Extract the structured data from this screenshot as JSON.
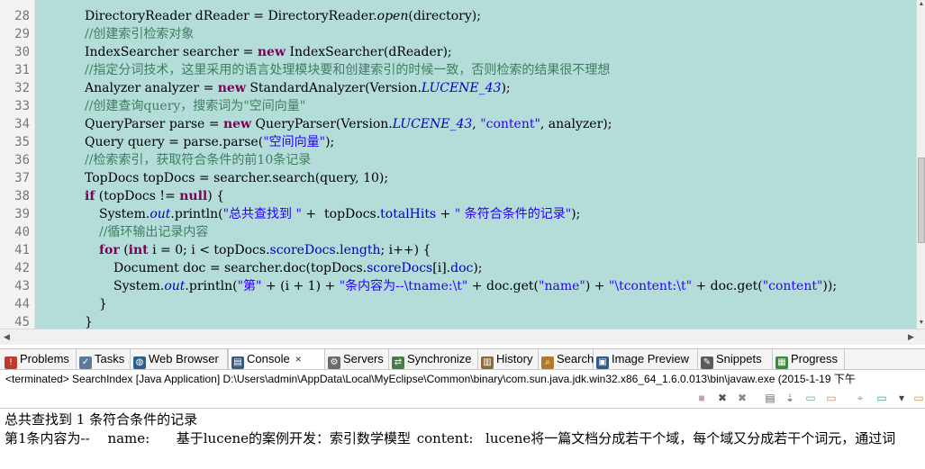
{
  "editor": {
    "line_numbers": [
      "28",
      "29",
      "30",
      "31",
      "32",
      "33",
      "34",
      "35",
      "36",
      "37",
      "38",
      "39",
      "40",
      "41",
      "42",
      "43",
      "44",
      "45"
    ],
    "lines": [
      [
        {
          "t": "DirectoryReader dReader = DirectoryReader.",
          "c": ""
        },
        {
          "t": "open",
          "c": "it"
        },
        {
          "t": "(directory);",
          "c": ""
        }
      ],
      [
        {
          "t": "//创建索引检索对象",
          "c": "cm"
        }
      ],
      [
        {
          "t": "IndexSearcher searcher = ",
          "c": ""
        },
        {
          "t": "new",
          "c": "kw"
        },
        {
          "t": " IndexSearcher(dReader);",
          "c": ""
        }
      ],
      [
        {
          "t": "//指定分词技术，这里采用的语言处理模块要和创建索引的时候一致，否则检索的结果很不理想",
          "c": "cm"
        }
      ],
      [
        {
          "t": "Analyzer analyzer = ",
          "c": ""
        },
        {
          "t": "new",
          "c": "kw"
        },
        {
          "t": " StandardAnalyzer(Version.",
          "c": ""
        },
        {
          "t": "LUCENE_43",
          "c": "sf"
        },
        {
          "t": ");",
          "c": ""
        }
      ],
      [
        {
          "t": "//创建查询query，搜索词为\"空间向量\"",
          "c": "cm"
        }
      ],
      [
        {
          "t": "QueryParser parse = ",
          "c": ""
        },
        {
          "t": "new",
          "c": "kw"
        },
        {
          "t": " QueryParser(Version.",
          "c": ""
        },
        {
          "t": "LUCENE_43",
          "c": "sf"
        },
        {
          "t": ", ",
          "c": ""
        },
        {
          "t": "\"content\"",
          "c": "st"
        },
        {
          "t": ", analyzer);",
          "c": ""
        }
      ],
      [
        {
          "t": "Query query = parse.parse(",
          "c": ""
        },
        {
          "t": "\"空间向量\"",
          "c": "st"
        },
        {
          "t": ");",
          "c": ""
        }
      ],
      [
        {
          "t": "//检索索引，获取符合条件的前10条记录",
          "c": "cm"
        }
      ],
      [
        {
          "t": "TopDocs topDocs = searcher.search(query, 10);",
          "c": ""
        }
      ],
      [
        {
          "t": "if",
          "c": "kw"
        },
        {
          "t": " (topDocs != ",
          "c": ""
        },
        {
          "t": "null",
          "c": "kw"
        },
        {
          "t": ") {",
          "c": ""
        }
      ],
      [
        {
          "t": "System.",
          "c": ""
        },
        {
          "t": "out",
          "c": "sf"
        },
        {
          "t": ".println(",
          "c": ""
        },
        {
          "t": "\"总共查找到 \"",
          "c": "st"
        },
        {
          "t": " +  topDocs.",
          "c": ""
        },
        {
          "t": "totalHits",
          "c": "fd"
        },
        {
          "t": " + ",
          "c": ""
        },
        {
          "t": "\" 条符合条件的记录\"",
          "c": "st"
        },
        {
          "t": ");",
          "c": ""
        }
      ],
      [
        {
          "t": "//循环输出记录内容",
          "c": "cm"
        }
      ],
      [
        {
          "t": "for",
          "c": "kw"
        },
        {
          "t": " (",
          "c": ""
        },
        {
          "t": "int",
          "c": "kw"
        },
        {
          "t": " i = 0; i < topDocs.",
          "c": ""
        },
        {
          "t": "scoreDocs",
          "c": "fd"
        },
        {
          "t": ".",
          "c": ""
        },
        {
          "t": "length",
          "c": "fd"
        },
        {
          "t": "; i++) {",
          "c": ""
        }
      ],
      [
        {
          "t": "Document doc = searcher.doc(topDocs.",
          "c": ""
        },
        {
          "t": "scoreDocs",
          "c": "fd"
        },
        {
          "t": "[i].",
          "c": ""
        },
        {
          "t": "doc",
          "c": "fd"
        },
        {
          "t": ");",
          "c": ""
        }
      ],
      [
        {
          "t": "System.",
          "c": ""
        },
        {
          "t": "out",
          "c": "sf"
        },
        {
          "t": ".println(",
          "c": ""
        },
        {
          "t": "\"第\"",
          "c": "st"
        },
        {
          "t": " + (i + 1) + ",
          "c": ""
        },
        {
          "t": "\"条内容为--\\tname:\\t\"",
          "c": "st"
        },
        {
          "t": " + doc.get(",
          "c": ""
        },
        {
          "t": "\"name\"",
          "c": "st"
        },
        {
          "t": ") + ",
          "c": ""
        },
        {
          "t": "\"\\tcontent:\\t\"",
          "c": "st"
        },
        {
          "t": " + doc.get(",
          "c": ""
        },
        {
          "t": "\"content\"",
          "c": "st"
        },
        {
          "t": "));",
          "c": ""
        }
      ],
      [
        {
          "t": "}",
          "c": ""
        }
      ],
      [
        {
          "t": "}",
          "c": ""
        }
      ]
    ]
  },
  "tabs": [
    {
      "label": "Problems",
      "icon": "problems-icon",
      "glyph": "!",
      "color": "#c0392b"
    },
    {
      "label": "Tasks",
      "icon": "tasks-icon",
      "glyph": "✓",
      "color": "#5d7a99"
    },
    {
      "label": "Web Browser",
      "icon": "globe-icon",
      "glyph": "◍",
      "color": "#2c5f8a"
    },
    {
      "label": "Console",
      "icon": "console-icon",
      "glyph": "▤",
      "color": "#3d5a80",
      "active": true
    },
    {
      "label": "Servers",
      "icon": "servers-icon",
      "glyph": "⚙",
      "color": "#6b6b6b"
    },
    {
      "label": "Synchronize",
      "icon": "synchronize-icon",
      "glyph": "⇄",
      "color": "#4a7a4a"
    },
    {
      "label": "History",
      "icon": "history-icon",
      "glyph": "▥",
      "color": "#8a6d3b"
    },
    {
      "label": "Search",
      "icon": "search-icon",
      "glyph": "⌕",
      "color": "#b07a2a"
    },
    {
      "label": "Image Preview",
      "icon": "image-preview-icon",
      "glyph": "▣",
      "color": "#2e5c8a"
    },
    {
      "label": "Snippets",
      "icon": "snippets-icon",
      "glyph": "✎",
      "color": "#5a5a5a"
    },
    {
      "label": "Progress",
      "icon": "progress-icon",
      "glyph": "▦",
      "color": "#3c8a3c"
    }
  ],
  "console": {
    "header": "<terminated> SearchIndex [Java Application] D:\\Users\\admin\\AppData\\Local\\MyEclipse\\Common\\binary\\com.sun.java.jdk.win32.x86_64_1.6.0.013\\bin\\javaw.exe (2015-1-19 下午",
    "output": [
      "总共查找到 1 条符合条件的记录",
      "第1条内容为--\tname:\t基于lucene的案例开发：索引数学模型\tcontent:\tlucene将一篇文档分成若干个域，每个域又分成若干个词元，通过词"
    ],
    "toolbar_icons": [
      "terminate-icon",
      "remove-launch-icon",
      "remove-all-icon",
      "clear-console-icon",
      "scroll-lock-icon",
      "show-on-output-icon",
      "show-on-error-icon",
      "pin-console-icon",
      "display-console-icon",
      "display-dropdown-icon",
      "open-console-icon"
    ]
  }
}
